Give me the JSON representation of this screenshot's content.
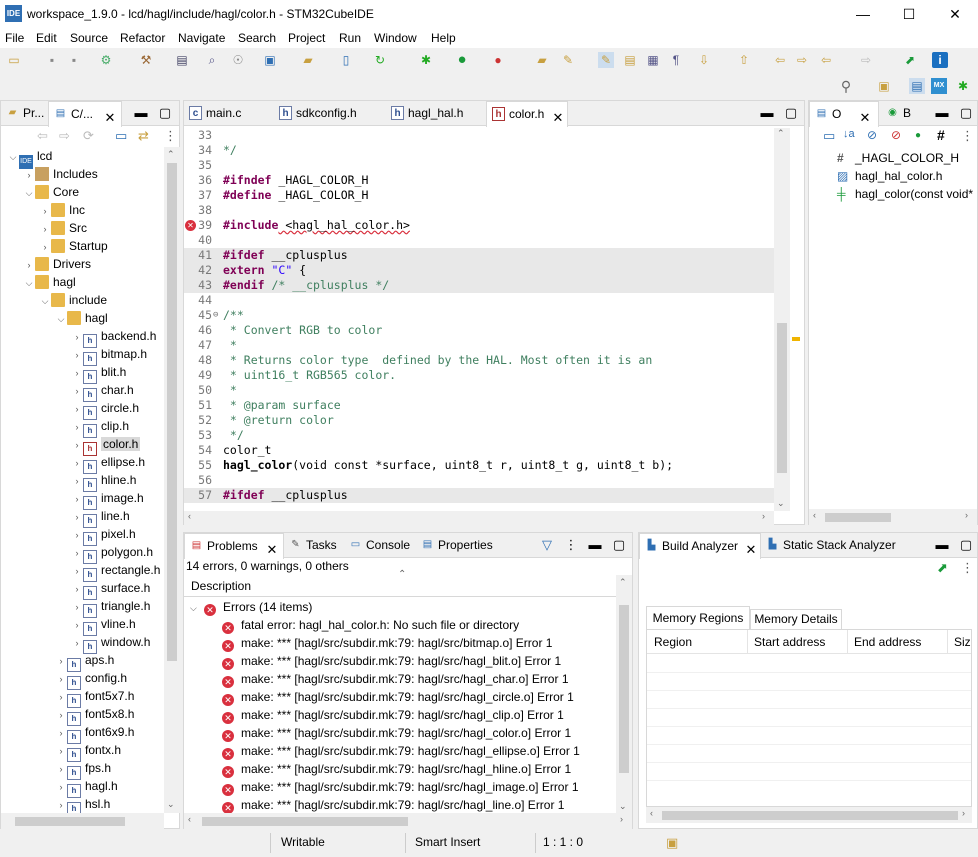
{
  "window": {
    "title": "workspace_1.9.0 - lcd/hagl/include/hagl/color.h - STM32CubeIDE",
    "app_icon": "IDE",
    "minimize": "—",
    "maximize": "☐",
    "close": "✕"
  },
  "menu": [
    "File",
    "Edit",
    "Source",
    "Refactor",
    "Navigate",
    "Search",
    "Project",
    "Run",
    "Window",
    "Help"
  ],
  "left_panel": {
    "tabs": [
      "Pr...",
      "C/..."
    ],
    "tree": [
      {
        "label": "lcd",
        "indent": 0,
        "tw": "⌵",
        "icon": "proj"
      },
      {
        "label": "Includes",
        "indent": 1,
        "tw": "›",
        "icon": "inc"
      },
      {
        "label": "Core",
        "indent": 1,
        "tw": "⌵",
        "icon": "folder"
      },
      {
        "label": "Inc",
        "indent": 2,
        "tw": "›",
        "icon": "folder"
      },
      {
        "label": "Src",
        "indent": 2,
        "tw": "›",
        "icon": "folder"
      },
      {
        "label": "Startup",
        "indent": 2,
        "tw": "›",
        "icon": "folder"
      },
      {
        "label": "Drivers",
        "indent": 1,
        "tw": "›",
        "icon": "folder"
      },
      {
        "label": "hagl",
        "indent": 1,
        "tw": "⌵",
        "icon": "folder"
      },
      {
        "label": "include",
        "indent": 2,
        "tw": "⌵",
        "icon": "folder"
      },
      {
        "label": "hagl",
        "indent": 3,
        "tw": "⌵",
        "icon": "folder"
      },
      {
        "label": "backend.h",
        "indent": 4,
        "tw": "›",
        "icon": "file"
      },
      {
        "label": "bitmap.h",
        "indent": 4,
        "tw": "›",
        "icon": "file"
      },
      {
        "label": "blit.h",
        "indent": 4,
        "tw": "›",
        "icon": "file"
      },
      {
        "label": "char.h",
        "indent": 4,
        "tw": "›",
        "icon": "file"
      },
      {
        "label": "circle.h",
        "indent": 4,
        "tw": "›",
        "icon": "file"
      },
      {
        "label": "clip.h",
        "indent": 4,
        "tw": "›",
        "icon": "file"
      },
      {
        "label": "color.h",
        "indent": 4,
        "tw": "›",
        "icon": "file",
        "selected": true
      },
      {
        "label": "ellipse.h",
        "indent": 4,
        "tw": "›",
        "icon": "file"
      },
      {
        "label": "hline.h",
        "indent": 4,
        "tw": "›",
        "icon": "file"
      },
      {
        "label": "image.h",
        "indent": 4,
        "tw": "›",
        "icon": "file"
      },
      {
        "label": "line.h",
        "indent": 4,
        "tw": "›",
        "icon": "file"
      },
      {
        "label": "pixel.h",
        "indent": 4,
        "tw": "›",
        "icon": "file"
      },
      {
        "label": "polygon.h",
        "indent": 4,
        "tw": "›",
        "icon": "file"
      },
      {
        "label": "rectangle.h",
        "indent": 4,
        "tw": "›",
        "icon": "file"
      },
      {
        "label": "surface.h",
        "indent": 4,
        "tw": "›",
        "icon": "file"
      },
      {
        "label": "triangle.h",
        "indent": 4,
        "tw": "›",
        "icon": "file"
      },
      {
        "label": "vline.h",
        "indent": 4,
        "tw": "›",
        "icon": "file"
      },
      {
        "label": "window.h",
        "indent": 4,
        "tw": "›",
        "icon": "file"
      },
      {
        "label": "aps.h",
        "indent": 3,
        "tw": "›",
        "icon": "file"
      },
      {
        "label": "config.h",
        "indent": 3,
        "tw": "›",
        "icon": "file"
      },
      {
        "label": "font5x7.h",
        "indent": 3,
        "tw": "›",
        "icon": "file"
      },
      {
        "label": "font5x8.h",
        "indent": 3,
        "tw": "›",
        "icon": "file"
      },
      {
        "label": "font6x9.h",
        "indent": 3,
        "tw": "›",
        "icon": "file"
      },
      {
        "label": "fontx.h",
        "indent": 3,
        "tw": "›",
        "icon": "file"
      },
      {
        "label": "fps.h",
        "indent": 3,
        "tw": "›",
        "icon": "file"
      },
      {
        "label": "hagl.h",
        "indent": 3,
        "tw": "›",
        "icon": "file"
      },
      {
        "label": "hsl.h",
        "indent": 3,
        "tw": "›",
        "icon": "file"
      }
    ]
  },
  "editor": {
    "tabs": [
      "main.c",
      "sdkconfig.h",
      "hagl_hal.h",
      "color.h"
    ],
    "active_tab": "color.h",
    "lines": [
      {
        "n": "33",
        "t": ""
      },
      {
        "n": "34",
        "t": "*/",
        "cls": "cm"
      },
      {
        "n": "35",
        "t": ""
      },
      {
        "n": "36",
        "t": "#ifndef _HAGL_COLOR_H",
        "kw": "#ifndef",
        "rest": " _HAGL_COLOR_H"
      },
      {
        "n": "37",
        "t": "#define _HAGL_COLOR_H",
        "kw": "#define",
        "rest": " _HAGL_COLOR_H"
      },
      {
        "n": "38",
        "t": ""
      },
      {
        "n": "39",
        "t": "#include <hagl_hal_color.h>",
        "kw": "#include",
        "rest": " <hagl_hal_color.h>",
        "err": true
      },
      {
        "n": "40",
        "t": ""
      },
      {
        "n": "41",
        "t": "#ifdef __cplusplus",
        "kw": "#ifdef",
        "rest": " __cplusplus",
        "hl": true
      },
      {
        "n": "42",
        "t": "extern \"C\" {",
        "kw": "extern",
        "str": " \"C\"",
        "rest": " {",
        "hl": true
      },
      {
        "n": "43",
        "t": "#endif /* __cplusplus */",
        "kw": "#endif",
        "cm": " /* __cplusplus */",
        "hl": true
      },
      {
        "n": "44",
        "t": ""
      },
      {
        "n": "45",
        "t": "/**",
        "cls": "cm"
      },
      {
        "n": "46",
        "t": " * Convert RGB to color",
        "cls": "cm"
      },
      {
        "n": "47",
        "t": " *",
        "cls": "cm"
      },
      {
        "n": "48",
        "t": " * Returns color type  defined by the HAL. Most often it is an",
        "cls": "cm"
      },
      {
        "n": "49",
        "t": " * uint16_t RGB565 color.",
        "cls": "cm"
      },
      {
        "n": "50",
        "t": " *",
        "cls": "cm"
      },
      {
        "n": "51",
        "t": " * @param surface",
        "cls": "cm"
      },
      {
        "n": "52",
        "t": " * @return color",
        "cls": "cm"
      },
      {
        "n": "53",
        "t": " */",
        "cls": "cm"
      },
      {
        "n": "54",
        "t": "color_t"
      },
      {
        "n": "55",
        "t": "hagl_color(void const *surface, uint8_t r, uint8_t g, uint8_t b);",
        "bold": "hagl_color"
      },
      {
        "n": "56",
        "t": ""
      },
      {
        "n": "57",
        "t": "#ifdef __cplusplus",
        "kw": "#ifdef",
        "rest": " __cplusplus",
        "hl": true
      }
    ]
  },
  "outline": {
    "tabs": [
      "O",
      "B"
    ],
    "items": [
      "_HAGL_COLOR_H",
      "hagl_hal_color.h",
      "hagl_color(const void*"
    ]
  },
  "problems": {
    "tabs": [
      "Problems",
      "Tasks",
      "Console",
      "Properties"
    ],
    "summary": "14 errors, 0 warnings, 0 others",
    "column": "Description",
    "group": "Errors (14 items)",
    "rows": [
      "fatal error: hagl_hal_color.h: No such file or directory",
      "make: *** [hagl/src/subdir.mk:79: hagl/src/bitmap.o] Error 1",
      "make: *** [hagl/src/subdir.mk:79: hagl/src/hagl_blit.o] Error 1",
      "make: *** [hagl/src/subdir.mk:79: hagl/src/hagl_char.o] Error 1",
      "make: *** [hagl/src/subdir.mk:79: hagl/src/hagl_circle.o] Error 1",
      "make: *** [hagl/src/subdir.mk:79: hagl/src/hagl_clip.o] Error 1",
      "make: *** [hagl/src/subdir.mk:79: hagl/src/hagl_color.o] Error 1",
      "make: *** [hagl/src/subdir.mk:79: hagl/src/hagl_ellipse.o] Error 1",
      "make: *** [hagl/src/subdir.mk:79: hagl/src/hagl_hline.o] Error 1",
      "make: *** [hagl/src/subdir.mk:79: hagl/src/hagl_image.o] Error 1",
      "make: *** [hagl/src/subdir.mk:79: hagl/src/hagl_line.o] Error 1"
    ]
  },
  "build": {
    "tabs": [
      "Build Analyzer",
      "Static Stack Analyzer"
    ],
    "subtabs": [
      "Memory Regions",
      "Memory Details"
    ],
    "columns": [
      "Region",
      "Start address",
      "End address",
      "Size"
    ]
  },
  "status": {
    "writable": "Writable",
    "insert": "Smart Insert",
    "position": "1 : 1 : 0"
  }
}
